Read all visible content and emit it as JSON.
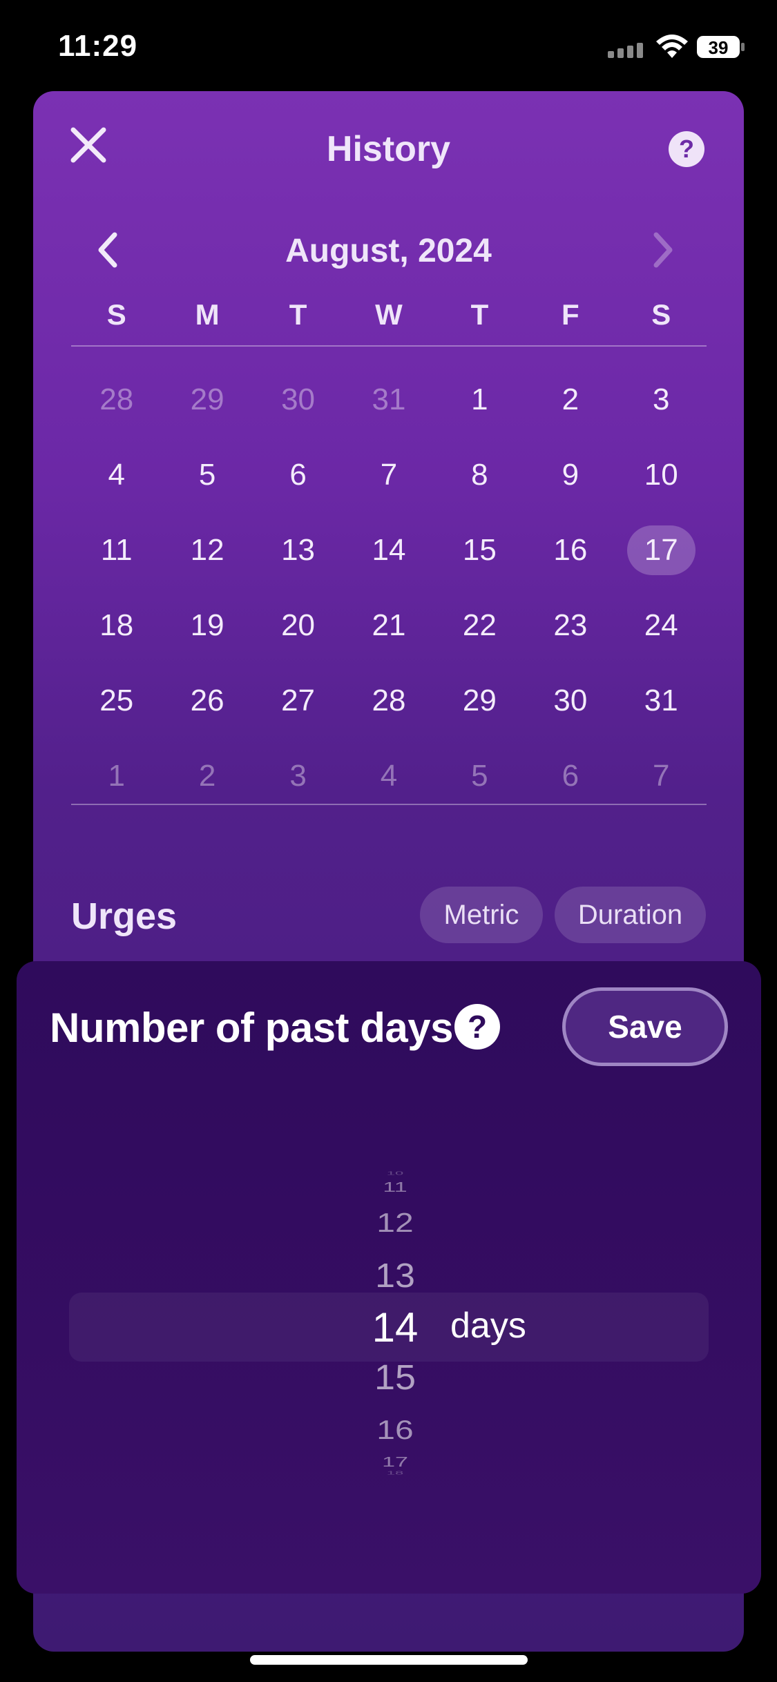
{
  "status_bar": {
    "time": "11:29",
    "battery": "39"
  },
  "history": {
    "title": "History",
    "month": "August, 2024",
    "weekdays": [
      "S",
      "M",
      "T",
      "W",
      "T",
      "F",
      "S"
    ],
    "weeks": [
      [
        {
          "d": "28",
          "m": true
        },
        {
          "d": "29",
          "m": true
        },
        {
          "d": "30",
          "m": true
        },
        {
          "d": "31",
          "m": true
        },
        {
          "d": "1"
        },
        {
          "d": "2"
        },
        {
          "d": "3"
        }
      ],
      [
        {
          "d": "4"
        },
        {
          "d": "5"
        },
        {
          "d": "6"
        },
        {
          "d": "7"
        },
        {
          "d": "8"
        },
        {
          "d": "9"
        },
        {
          "d": "10"
        }
      ],
      [
        {
          "d": "11"
        },
        {
          "d": "12"
        },
        {
          "d": "13"
        },
        {
          "d": "14"
        },
        {
          "d": "15"
        },
        {
          "d": "16"
        },
        {
          "d": "17",
          "s": true
        }
      ],
      [
        {
          "d": "18"
        },
        {
          "d": "19"
        },
        {
          "d": "20"
        },
        {
          "d": "21"
        },
        {
          "d": "22"
        },
        {
          "d": "23"
        },
        {
          "d": "24"
        }
      ],
      [
        {
          "d": "25"
        },
        {
          "d": "26"
        },
        {
          "d": "27"
        },
        {
          "d": "28"
        },
        {
          "d": "29"
        },
        {
          "d": "30"
        },
        {
          "d": "31"
        }
      ],
      [
        {
          "d": "1",
          "m": true
        },
        {
          "d": "2",
          "m": true
        },
        {
          "d": "3",
          "m": true
        },
        {
          "d": "4",
          "m": true
        },
        {
          "d": "5",
          "m": true
        },
        {
          "d": "6",
          "m": true
        },
        {
          "d": "7",
          "m": true
        }
      ]
    ],
    "urges_title": "Urges",
    "chips": {
      "metric": "Metric",
      "duration": "Duration"
    }
  },
  "sheet": {
    "title": "Number of past days",
    "help_icon": "?",
    "save_label": "Save",
    "picker": {
      "values": [
        "10",
        "11",
        "12",
        "13",
        "14",
        "15",
        "16",
        "17",
        "18"
      ],
      "selected": "14",
      "unit": "days"
    }
  },
  "colors": {
    "accent": "#7b31b3",
    "sheet": "#2f0b5c"
  }
}
